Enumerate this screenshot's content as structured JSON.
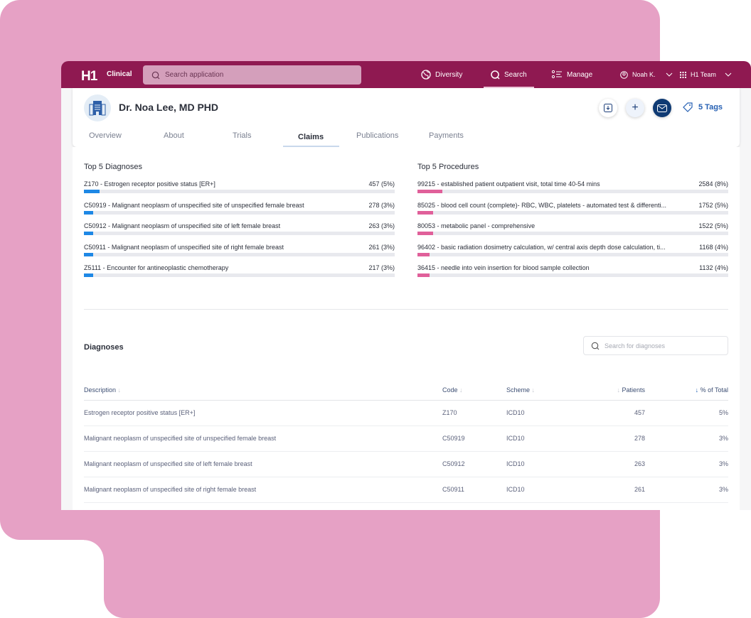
{
  "nav": {
    "logo": "H1",
    "product": "Clinical",
    "search_placeholder": "Search application",
    "items": [
      {
        "label": "Diversity",
        "icon": "globe-icon"
      },
      {
        "label": "Search",
        "icon": "search-icon",
        "active": true
      },
      {
        "label": "Manage",
        "icon": "list-icon"
      }
    ],
    "user": "Noah K.",
    "team": "H1 Team"
  },
  "profile": {
    "name": "Dr. Noa Lee, MD PHD",
    "tags": "5 Tags"
  },
  "tabs": [
    "Overview",
    "About",
    "Trials",
    "Claims",
    "Publications",
    "Payments"
  ],
  "active_tab": "Claims",
  "top_diagnoses": {
    "title": "Top 5 Diagnoses",
    "color": "#1e88e5",
    "items": [
      {
        "label": "Z170 - Estrogen receptor positive status [ER+]",
        "value": "457 (5%)",
        "pct": 5
      },
      {
        "label": "C50919 - Malignant neoplasm of unspecified site of unspecified female breast",
        "value": "278 (3%)",
        "pct": 3
      },
      {
        "label": "C50912 - Malignant neoplasm of unspecified site of left female breast",
        "value": "263 (3%)",
        "pct": 3
      },
      {
        "label": "C50911 - Malignant neoplasm of unspecified site of right female breast",
        "value": "261 (3%)",
        "pct": 3
      },
      {
        "label": "Z5111 - Encounter for antineoplastic chemotherapy",
        "value": "217 (3%)",
        "pct": 3
      }
    ]
  },
  "top_procedures": {
    "title": "Top 5 Procedures",
    "color": "#e0609a",
    "items": [
      {
        "label": "99215 - established patient outpatient visit, total time 40-54 mins",
        "value": "2584 (8%)",
        "pct": 8
      },
      {
        "label": "85025 - blood cell count (complete)- RBC, WBC, platelets - automated test & differenti...",
        "value": "1752 (5%)",
        "pct": 5
      },
      {
        "label": "80053 - metabolic panel - comprehensive",
        "value": "1522 (5%)",
        "pct": 5
      },
      {
        "label": "96402 - basic radiation dosimetry calculation, w/ central axis depth dose calculation, ti...",
        "value": "1168 (4%)",
        "pct": 4
      },
      {
        "label": "36415 - needle into vein insertion for blood sample collection",
        "value": "1132 (4%)",
        "pct": 4
      }
    ]
  },
  "diagnoses": {
    "title": "Diagnoses",
    "search_placeholder": "Search for diagnoses",
    "columns": [
      "Description",
      "Code",
      "Scheme",
      "Patients",
      "% of Total"
    ],
    "rows": [
      [
        "Estrogen receptor positive status [ER+]",
        "Z170",
        "ICD10",
        "457",
        "5%"
      ],
      [
        "Malignant neoplasm of unspecified site of unspecified female breast",
        "C50919",
        "ICD10",
        "278",
        "3%"
      ],
      [
        "Malignant neoplasm of unspecified site of left female breast",
        "C50912",
        "ICD10",
        "263",
        "3%"
      ],
      [
        "Malignant neoplasm of unspecified site of right female breast",
        "C50911",
        "ICD10",
        "261",
        "3%"
      ]
    ]
  }
}
